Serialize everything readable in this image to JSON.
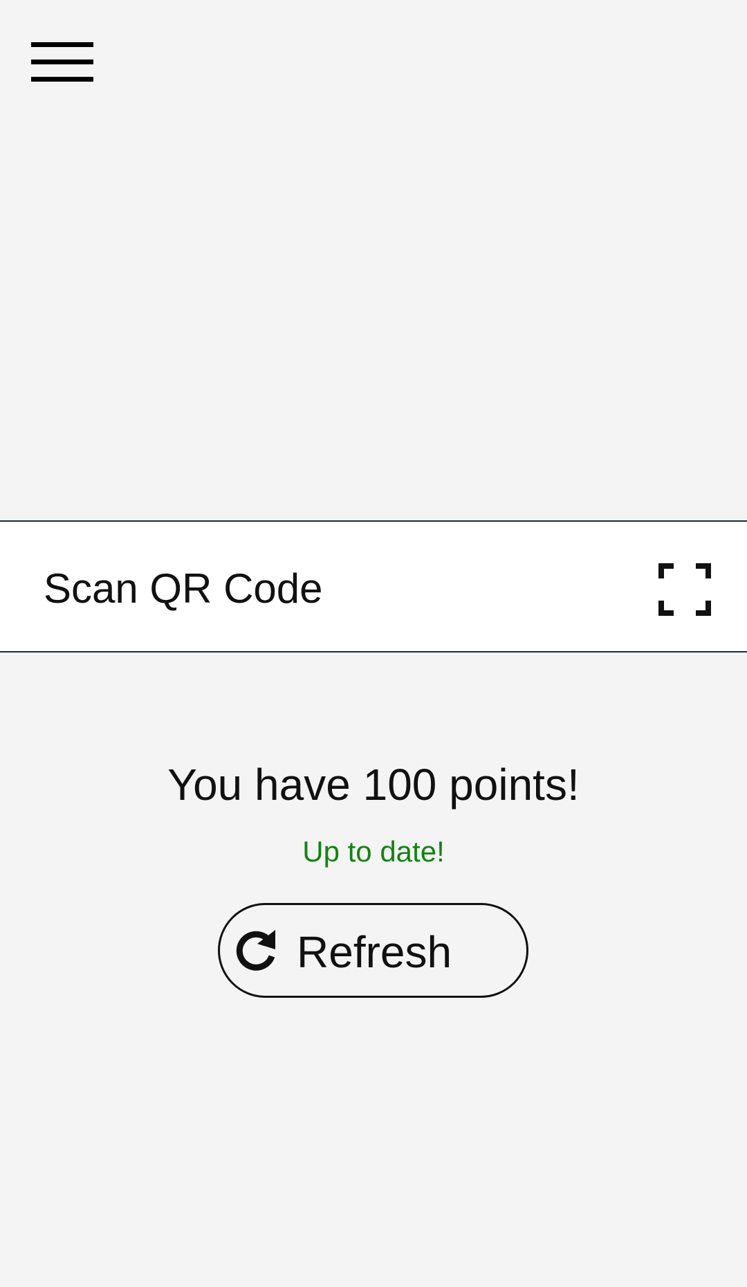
{
  "header": {
    "menu_icon": "hamburger-menu-icon"
  },
  "scan": {
    "label": "Scan QR Code",
    "icon": "scan-frame-icon"
  },
  "points": {
    "message": "You have 100 points!"
  },
  "status": {
    "text": "Up to date!",
    "color": "#128212"
  },
  "refresh": {
    "label": "Refresh",
    "icon": "refresh-icon"
  }
}
